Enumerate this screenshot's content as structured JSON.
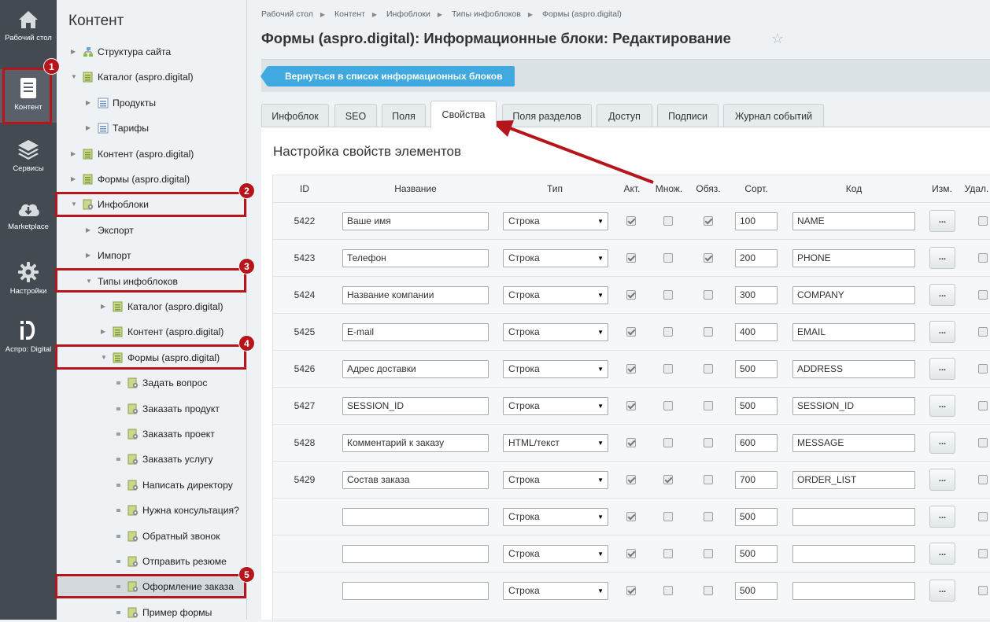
{
  "leftbar": {
    "items": [
      {
        "label": "Рабочий стол",
        "icon": "home-icon"
      },
      {
        "label": "Контент",
        "icon": "document-icon"
      },
      {
        "label": "Сервисы",
        "icon": "layers-icon"
      },
      {
        "label": "Marketplace",
        "icon": "cloud-download-icon"
      },
      {
        "label": "Настройки",
        "icon": "gear-icon"
      },
      {
        "label": "Аспро: Digital",
        "icon": "aspro-logo-icon"
      }
    ]
  },
  "tree": {
    "title": "Контент",
    "items": [
      "Структура сайта",
      "Каталог (aspro.digital)",
      "Продукты",
      "Тарифы",
      "Контент (aspro.digital)",
      "Формы (aspro.digital)",
      "Инфоблоки",
      "Экспорт",
      "Импорт",
      "Типы инфоблоков",
      "Каталог (aspro.digital)",
      "Контент (aspro.digital)",
      "Формы (aspro.digital)",
      "Задать вопрос",
      "Заказать продукт",
      "Заказать проект",
      "Заказать услугу",
      "Написать директору",
      "Нужна консультация?",
      "Обратный звонок",
      "Отправить резюме",
      "Оформление заказа",
      "Пример формы"
    ]
  },
  "annotations": [
    "1",
    "2",
    "3",
    "4",
    "5"
  ],
  "breadcrumbs": [
    "Рабочий стол",
    "Контент",
    "Инфоблоки",
    "Типы инфоблоков",
    "Формы (aspro.digital)"
  ],
  "page_title": "Формы (aspro.digital): Информационные блоки: Редактирование",
  "back_button": "Вернуться в список информационных блоков",
  "tabs": [
    "Инфоблок",
    "SEO",
    "Поля",
    "Свойства",
    "Поля разделов",
    "Доступ",
    "Подписи",
    "Журнал событий"
  ],
  "active_tab": "Свойства",
  "section_title": "Настройка свойств элементов",
  "table": {
    "headers": [
      "ID",
      "Название",
      "Тип",
      "Акт.",
      "Множ.",
      "Обяз.",
      "Сорт.",
      "Код",
      "Изм.",
      "Удал."
    ],
    "edit_button_label": "...",
    "rows": [
      {
        "id": "5422",
        "name": "Ваше имя",
        "type": "Строка",
        "active": true,
        "multiple": false,
        "required": true,
        "sort": "100",
        "code": "NAME",
        "delete": false
      },
      {
        "id": "5423",
        "name": "Телефон",
        "type": "Строка",
        "active": true,
        "multiple": false,
        "required": true,
        "sort": "200",
        "code": "PHONE",
        "delete": false
      },
      {
        "id": "5424",
        "name": "Название компании",
        "type": "Строка",
        "active": true,
        "multiple": false,
        "required": false,
        "sort": "300",
        "code": "COMPANY",
        "delete": false
      },
      {
        "id": "5425",
        "name": "E-mail",
        "type": "Строка",
        "active": true,
        "multiple": false,
        "required": false,
        "sort": "400",
        "code": "EMAIL",
        "delete": false
      },
      {
        "id": "5426",
        "name": "Адрес доставки",
        "type": "Строка",
        "active": true,
        "multiple": false,
        "required": false,
        "sort": "500",
        "code": "ADDRESS",
        "delete": false
      },
      {
        "id": "5427",
        "name": "SESSION_ID",
        "type": "Строка",
        "active": true,
        "multiple": false,
        "required": false,
        "sort": "500",
        "code": "SESSION_ID",
        "delete": false
      },
      {
        "id": "5428",
        "name": "Комментарий к заказу",
        "type": "HTML/текст",
        "active": true,
        "multiple": false,
        "required": false,
        "sort": "600",
        "code": "MESSAGE",
        "delete": false
      },
      {
        "id": "5429",
        "name": "Состав заказа",
        "type": "Строка",
        "active": true,
        "multiple": true,
        "required": false,
        "sort": "700",
        "code": "ORDER_LIST",
        "delete": false
      },
      {
        "id": "",
        "name": "",
        "type": "Строка",
        "active": true,
        "multiple": false,
        "required": false,
        "sort": "500",
        "code": "",
        "delete": false
      },
      {
        "id": "",
        "name": "",
        "type": "Строка",
        "active": true,
        "multiple": false,
        "required": false,
        "sort": "500",
        "code": "",
        "delete": false
      },
      {
        "id": "",
        "name": "",
        "type": "Строка",
        "active": true,
        "multiple": false,
        "required": false,
        "sort": "500",
        "code": "",
        "delete": false
      }
    ]
  },
  "colors": {
    "accent": "#3fa9e0",
    "annotation": "#b5151b",
    "sidebar": "#434a52"
  }
}
